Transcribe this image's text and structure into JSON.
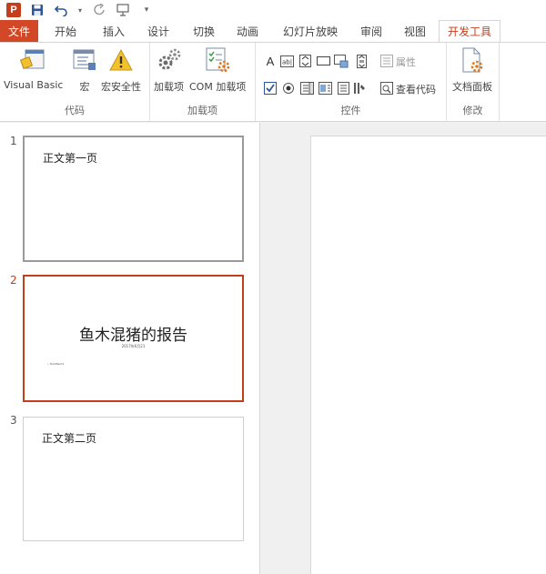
{
  "colors": {
    "accent": "#c43e1c",
    "file_tab": "#d24726",
    "selected_border": "#c43e1c"
  },
  "quick_access": {
    "logo_text": "P",
    "icons": [
      "powerpoint-logo-icon",
      "save-icon",
      "undo-icon",
      "redo-icon",
      "start-slideshow-icon",
      "customize-toolbar-icon"
    ]
  },
  "tabs": [
    {
      "label": "文件"
    },
    {
      "label": "开始"
    },
    {
      "label": "插入"
    },
    {
      "label": "设计"
    },
    {
      "label": "切换"
    },
    {
      "label": "动画"
    },
    {
      "label": "幻灯片放映"
    },
    {
      "label": "审阅"
    },
    {
      "label": "视图"
    },
    {
      "label": "开发工具",
      "active": true
    }
  ],
  "ribbon": {
    "code_group": {
      "label": "代码",
      "visual_basic": "Visual Basic",
      "macro": "宏",
      "macro_security": "宏安全性"
    },
    "addins_group": {
      "label": "加载项",
      "addins": "加载项",
      "com_addins": "COM 加载项"
    },
    "controls_group": {
      "label": "控件",
      "label_control": "A",
      "properties": "属性",
      "view_code": "查看代码"
    },
    "modify_group": {
      "label": "修改",
      "document_panel": "文档面板"
    }
  },
  "slides": [
    {
      "number": "1",
      "text": "正文第一页"
    },
    {
      "number": "2",
      "title": "鱼木混猪的报告",
      "subtitle": "2017年6月21",
      "tiny": "• Text/Rect1"
    },
    {
      "number": "3",
      "text": "正文第二页"
    }
  ]
}
